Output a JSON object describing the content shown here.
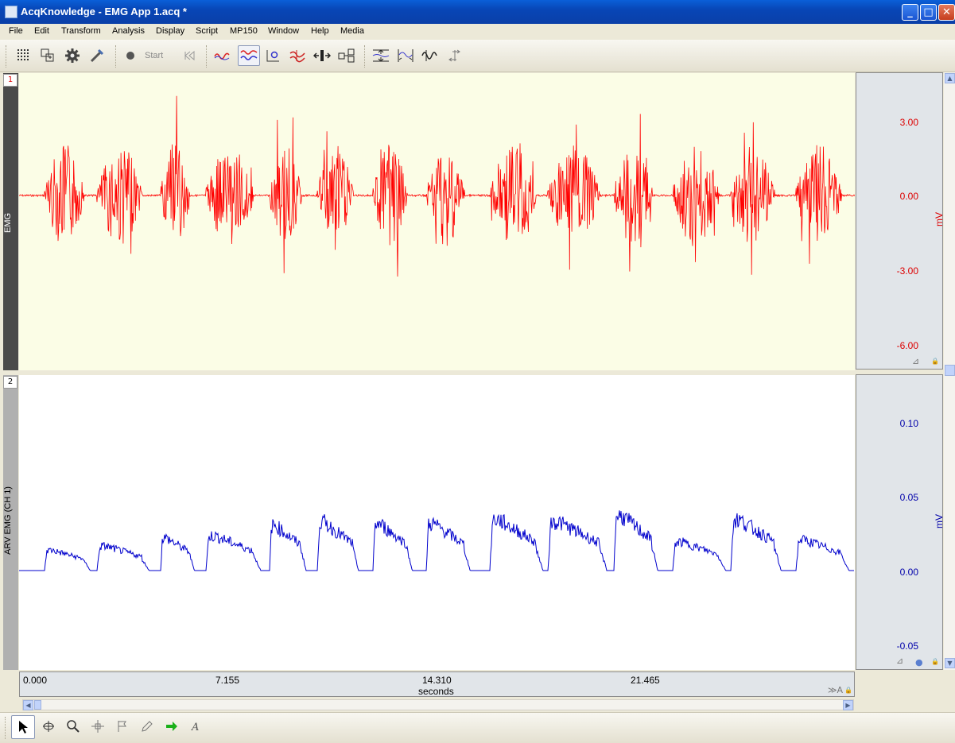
{
  "window": {
    "title": "AcqKnowledge - EMG App 1.acq *"
  },
  "menu": [
    "File",
    "Edit",
    "Transform",
    "Analysis",
    "Display",
    "Script",
    "MP150",
    "Window",
    "Help",
    "Media"
  ],
  "toolbar": {
    "start_label": "Start"
  },
  "channels": [
    {
      "number": "1",
      "label": "EMG",
      "unit": "mV",
      "color": "#ff0000",
      "ticks": [
        "3.00",
        "0.00",
        "-3.00",
        "-6.00"
      ],
      "background": "#fbfde6"
    },
    {
      "number": "2",
      "label": "ARV EMG (CH 1)",
      "unit": "mV",
      "color": "#0000cc",
      "ticks": [
        "0.10",
        "0.05",
        "0.00",
        "-0.05"
      ],
      "background": "#ffffff"
    }
  ],
  "xaxis": {
    "ticks": [
      "0.000",
      "7.155",
      "14.310",
      "21.465"
    ],
    "label": "seconds"
  }
}
